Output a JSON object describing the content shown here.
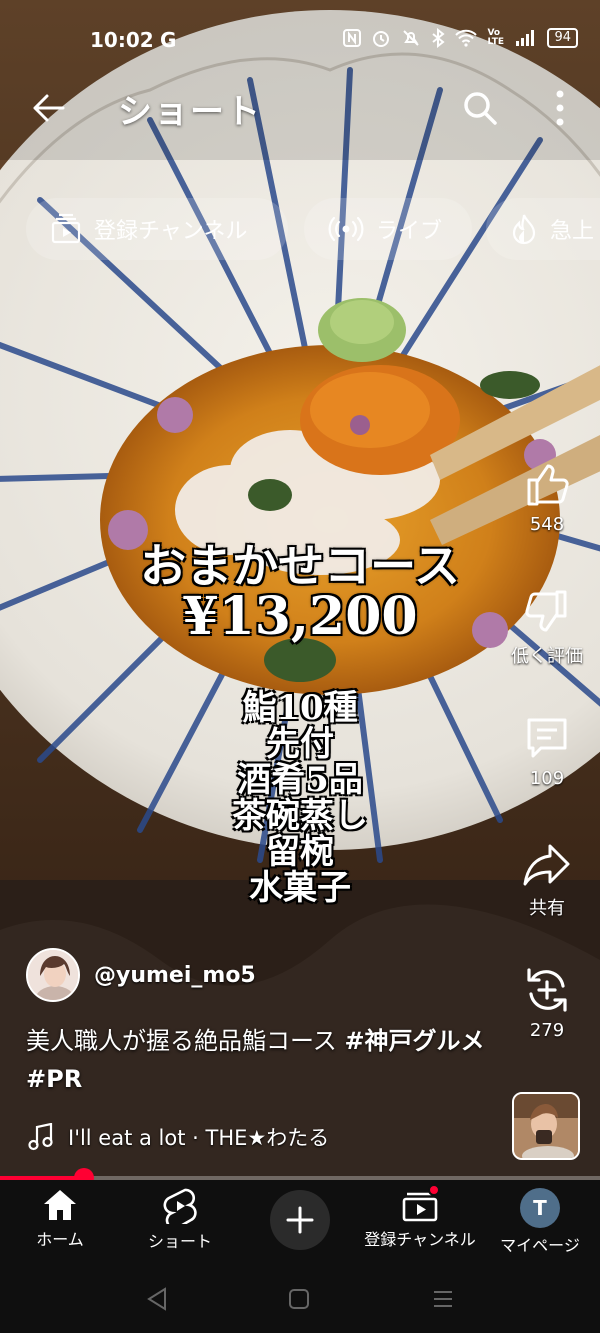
{
  "status_bar": {
    "time": "10:02",
    "google_indicator": "G",
    "battery_level": "94",
    "icons": [
      "nfc-icon",
      "alarm-icon",
      "mute-icon",
      "bluetooth-icon",
      "wifi-icon",
      "volte-icon",
      "signal-icon",
      "battery-icon"
    ],
    "volte_label": "Vo LTE"
  },
  "top_bar": {
    "title": "ショート",
    "back_icon": "arrow-left-icon",
    "search_icon": "search-icon",
    "more_icon": "more-vertical-icon"
  },
  "chips": [
    {
      "label": "登録チャンネル",
      "icon": "subscriptions-icon"
    },
    {
      "label": "ライブ",
      "icon": "live-icon"
    },
    {
      "label": "急上",
      "icon": "trending-icon"
    }
  ],
  "video_overlay": {
    "title": "おまかせコース",
    "price": "¥13,200",
    "menu": [
      "鮨10種",
      "先付",
      "酒肴5品",
      "茶碗蒸し",
      "留椀",
      "水菓子"
    ]
  },
  "actions": {
    "like_count": "548",
    "dislike_label": "低く評価",
    "comment_count": "109",
    "share_label": "共有",
    "remix_count": "279"
  },
  "channel": {
    "handle": "@yumei_mo5"
  },
  "description": {
    "text": "美人職人が握る絶品鮨コース ",
    "tag1": "#神戸グルメ",
    "tag2": "#PR"
  },
  "music": {
    "track": "I'll eat a lot · THE★わたる"
  },
  "progress": {
    "fraction": 0.14
  },
  "bottom_nav": {
    "home": "ホーム",
    "shorts": "ショート",
    "subscriptions": "登録チャンネル",
    "you": "マイページ",
    "you_initial": "T"
  },
  "colors": {
    "accent": "#ff0033",
    "nav_background": "#0f0f0f",
    "bowl_blue": "#2b4a8c",
    "sauce": "#d98a1a"
  }
}
